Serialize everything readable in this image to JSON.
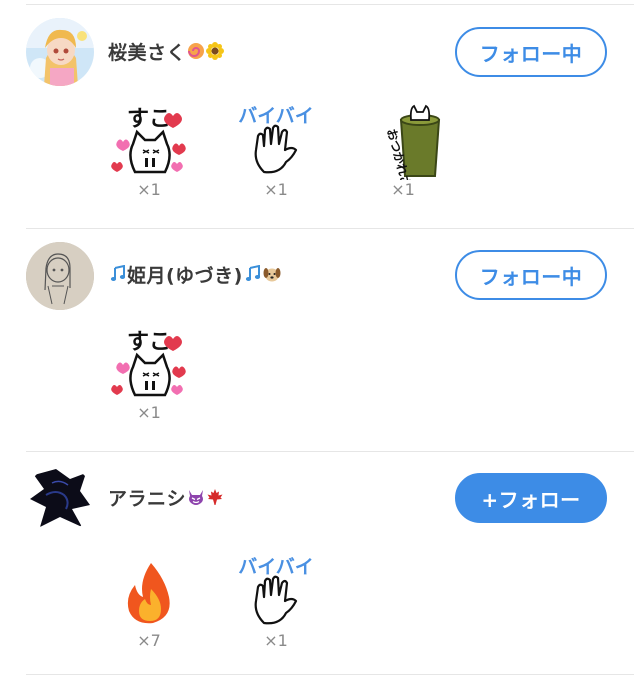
{
  "users": [
    {
      "name": "桜美さく",
      "name_emojis": [
        "pink-spiral-icon",
        "sunflower-icon"
      ],
      "follow_label": "フォロー中",
      "following": true,
      "reactions": [
        {
          "sticker": "suko-cat-hearts-sticker",
          "count": "×1"
        },
        {
          "sticker": "baibai-waving-hand-sticker",
          "count": "×1"
        },
        {
          "sticker": "otsukaresama-cat-bucket-sticker",
          "count": "×1"
        }
      ]
    },
    {
      "name": "姫月(ゆづき)",
      "name_emojis": [
        "music-notes-icon",
        "music-notes-icon",
        "dog-face-icon"
      ],
      "follow_label": "フォロー中",
      "following": true,
      "reactions": [
        {
          "sticker": "suko-cat-hearts-sticker",
          "count": "×1"
        }
      ]
    },
    {
      "name": "アラニシ",
      "name_emojis": [
        "purple-devil-icon",
        "maple-leaf-icon"
      ],
      "follow_label": "+フォロー",
      "following": false,
      "reactions": [
        {
          "sticker": "fire-sticker",
          "count": "×7"
        },
        {
          "sticker": "baibai-waving-hand-sticker",
          "count": "×1"
        }
      ]
    }
  ],
  "sticker_text": {
    "suko": "すこ",
    "baibai": "バイバイ",
    "otsukare": "おつかれさま"
  },
  "colors": {
    "accent": "#3d8ce6",
    "heart_red": "#e23a4e",
    "heart_pink": "#f26fb1",
    "count_gray": "#8a8a8a"
  }
}
